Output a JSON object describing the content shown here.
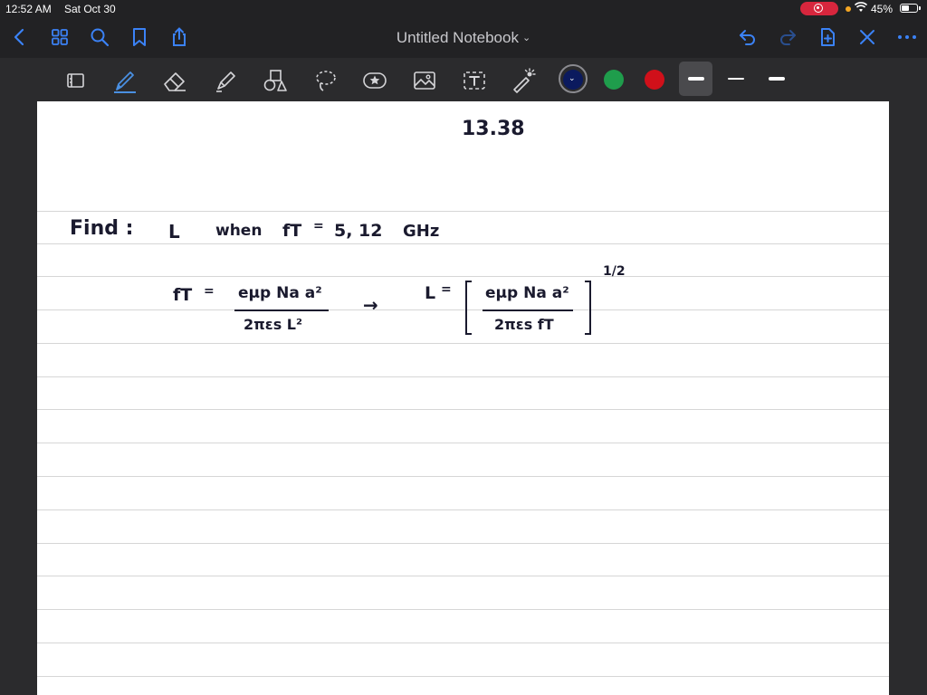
{
  "status_bar": {
    "time": "12:52 AM",
    "date": "Sat Oct 30",
    "battery_percent": "45%"
  },
  "nav": {
    "title": "Untitled Notebook",
    "icons": [
      "back-icon",
      "grid-icon",
      "search-icon",
      "bookmark-icon",
      "share-icon",
      "undo-icon",
      "redo-icon",
      "add-page-icon",
      "close-icon",
      "more-icon"
    ]
  },
  "toolbar": {
    "tools": [
      "page-layout-icon",
      "pen-icon",
      "eraser-icon",
      "highlighter-icon",
      "shapes-icon",
      "lasso-icon",
      "sticker-icon",
      "image-icon",
      "text-icon",
      "laser-pointer-icon"
    ],
    "selected_tool": "pen-icon",
    "colors": [
      "#0b1a5e",
      "#1f9d4c",
      "#d0101a"
    ],
    "selected_color": "#0b1a5e",
    "stroke_widths": [
      "thick",
      "thin",
      "medium"
    ],
    "selected_stroke": "thick"
  },
  "note": {
    "problem_number": "13.38",
    "find_line": {
      "find": "Find :",
      "variable": "L",
      "when": "when",
      "fT": "fT",
      "eq": "=",
      "values": "5, 12",
      "unit": "GHz"
    },
    "equation_left": {
      "lhs": "fT",
      "eq": "=",
      "numerator": "eμp Na a²",
      "denominator": "2πεs L²"
    },
    "arrow": "→",
    "equation_right": {
      "lhs": "L",
      "eq": "=",
      "numerator": "eμp Na a²",
      "denominator": "2πεs fT",
      "exponent": "1/2"
    }
  }
}
